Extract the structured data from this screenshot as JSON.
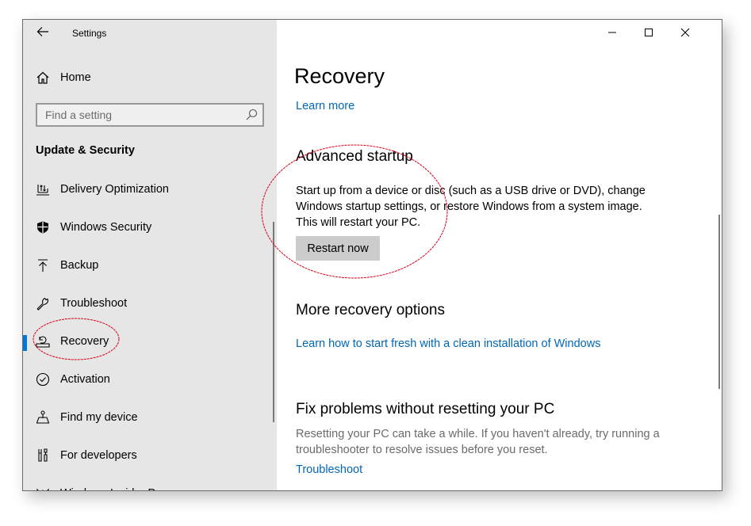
{
  "window": {
    "app_title": "Settings",
    "back_icon": "arrow-left-icon",
    "controls": {
      "minimize": "minimize-icon",
      "maximize": "maximize-icon",
      "close": "close-icon"
    }
  },
  "sidebar": {
    "home_label": "Home",
    "home_icon": "home-icon",
    "search": {
      "placeholder": "Find a setting",
      "value": "",
      "icon": "search-icon"
    },
    "section_title": "Update & Security",
    "items": [
      {
        "label": "Delivery Optimization",
        "icon": "delivery-optimization-icon",
        "active": false
      },
      {
        "label": "Windows Security",
        "icon": "shield-icon",
        "active": false
      },
      {
        "label": "Backup",
        "icon": "backup-arrow-icon",
        "active": false
      },
      {
        "label": "Troubleshoot",
        "icon": "wrench-icon",
        "active": false
      },
      {
        "label": "Recovery",
        "icon": "recovery-icon",
        "active": true
      },
      {
        "label": "Activation",
        "icon": "check-circle-icon",
        "active": false
      },
      {
        "label": "Find my device",
        "icon": "find-device-icon",
        "active": false
      },
      {
        "label": "For developers",
        "icon": "developer-tools-icon",
        "active": false
      },
      {
        "label": "Windows Insider Program",
        "icon": "insider-icon",
        "active": false
      }
    ]
  },
  "content": {
    "title": "Recovery",
    "learn_more": "Learn more",
    "advanced_startup": {
      "heading": "Advanced startup",
      "description": "Start up from a device or disc (such as a USB drive or DVD), change Windows startup settings, or restore Windows from a system image. This will restart your PC.",
      "button": "Restart now"
    },
    "more_options": {
      "heading": "More recovery options",
      "link": "Learn how to start fresh with a clean installation of Windows"
    },
    "fix_problems": {
      "heading": "Fix problems without resetting your PC",
      "description": "Resetting your PC can take a while. If you haven't already, try running a troubleshooter to resolve issues before you reset.",
      "link": "Troubleshoot"
    }
  },
  "colors": {
    "accent": "#0078d7",
    "link": "#0067b8",
    "annotation": "#d9001b"
  }
}
